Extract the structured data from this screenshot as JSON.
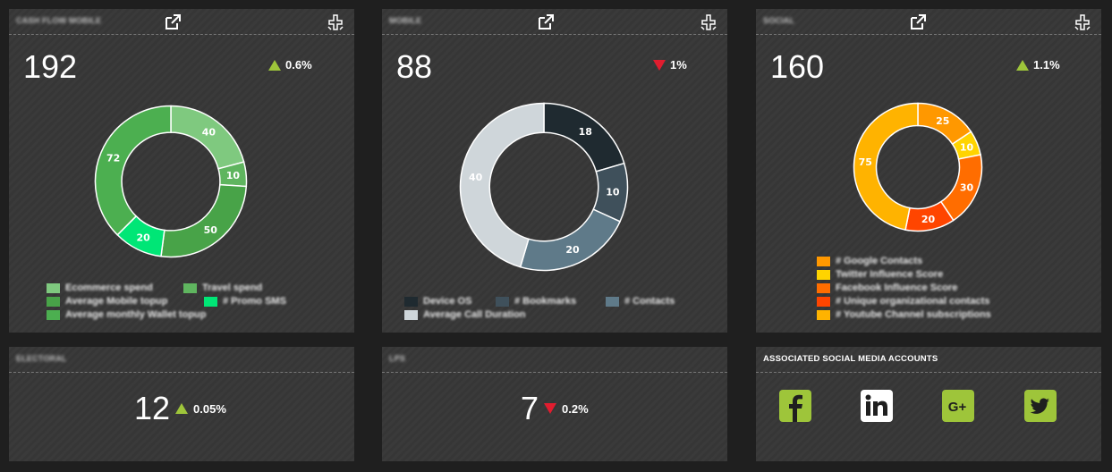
{
  "cards": {
    "cashflow": {
      "title": "CASH FLOW MOBILE",
      "value": "192",
      "delta": "0.6%",
      "delta_dir": "up",
      "legend": [
        {
          "label": "Ecommerce spend",
          "color": "#7fc97f"
        },
        {
          "label": "Travel spend",
          "color": "#5fb55f"
        },
        {
          "label": "Average Mobile topup",
          "color": "#48a348"
        },
        {
          "label": "# Promo SMS",
          "color": "#00e676"
        },
        {
          "label": "Average monthly Wallet topup",
          "color": "#4caf50"
        }
      ]
    },
    "mobile": {
      "title": "MOBILE",
      "value": "88",
      "delta": "1%",
      "delta_dir": "down",
      "legend": [
        {
          "label": "Device OS",
          "color": "#1f2a30"
        },
        {
          "label": "# Bookmarks",
          "color": "#3f505b"
        },
        {
          "label": "# Contacts",
          "color": "#5f7a89"
        },
        {
          "label": "Average Call Duration",
          "color": "#cfd6da"
        }
      ]
    },
    "social": {
      "title": "SOCIAL",
      "value": "160",
      "delta": "1.1%",
      "delta_dir": "up",
      "legend": [
        {
          "label": "# Google Contacts",
          "color": "#ff9800"
        },
        {
          "label": "Twitter Influence Score",
          "color": "#ffd400"
        },
        {
          "label": "Facebook Influence Score",
          "color": "#ff6d00"
        },
        {
          "label": "# Unique organizational contacts",
          "color": "#ff4500"
        },
        {
          "label": "# Youtube Channel subscriptions",
          "color": "#ffb300"
        }
      ]
    },
    "electoral": {
      "title": "ELECTORAL",
      "value": "12",
      "delta": "0.05%",
      "delta_dir": "up"
    },
    "lps": {
      "title": "LPS",
      "value": "7",
      "delta": "0.2%",
      "delta_dir": "down"
    },
    "social_accounts": {
      "title": "ASSOCIATED SOCIAL MEDIA ACCOUNTS",
      "icons": [
        {
          "name": "facebook",
          "glyph": "f",
          "color": "#9ec53a"
        },
        {
          "name": "linkedin",
          "glyph": "in",
          "color": "#ffffff"
        },
        {
          "name": "google-plus",
          "glyph": "G+",
          "color": "#9ec53a"
        },
        {
          "name": "twitter",
          "glyph": "bird",
          "color": "#9ec53a"
        }
      ]
    }
  },
  "chart_data": [
    {
      "type": "pie",
      "id": "cashflow",
      "categories": [
        "Ecommerce spend",
        "Travel spend",
        "Average Mobile topup",
        "# Promo SMS",
        "Average monthly Wallet topup"
      ],
      "values": [
        40,
        10,
        50,
        20,
        72
      ],
      "colors": [
        "#7fc97f",
        "#5fb55f",
        "#48a348",
        "#00e676",
        "#4caf50"
      ],
      "title": "",
      "legend": "bottom"
    },
    {
      "type": "pie",
      "id": "mobile",
      "categories": [
        "Device OS",
        "# Bookmarks",
        "# Contacts",
        "Average Call Duration"
      ],
      "values": [
        18,
        10,
        20,
        40
      ],
      "colors": [
        "#1f2a30",
        "#3f505b",
        "#5f7a89",
        "#cfd6da"
      ],
      "title": "",
      "legend": "bottom"
    },
    {
      "type": "pie",
      "id": "social",
      "categories": [
        "# Google Contacts",
        "Twitter Influence Score",
        "Facebook Influence Score",
        "# Unique organizational contacts",
        "# Youtube Channel subscriptions"
      ],
      "values": [
        25,
        10,
        30,
        20,
        75
      ],
      "colors": [
        "#ff9800",
        "#ffd400",
        "#ff6d00",
        "#ff4500",
        "#ffb300"
      ],
      "title": "",
      "legend": "bottom"
    }
  ]
}
